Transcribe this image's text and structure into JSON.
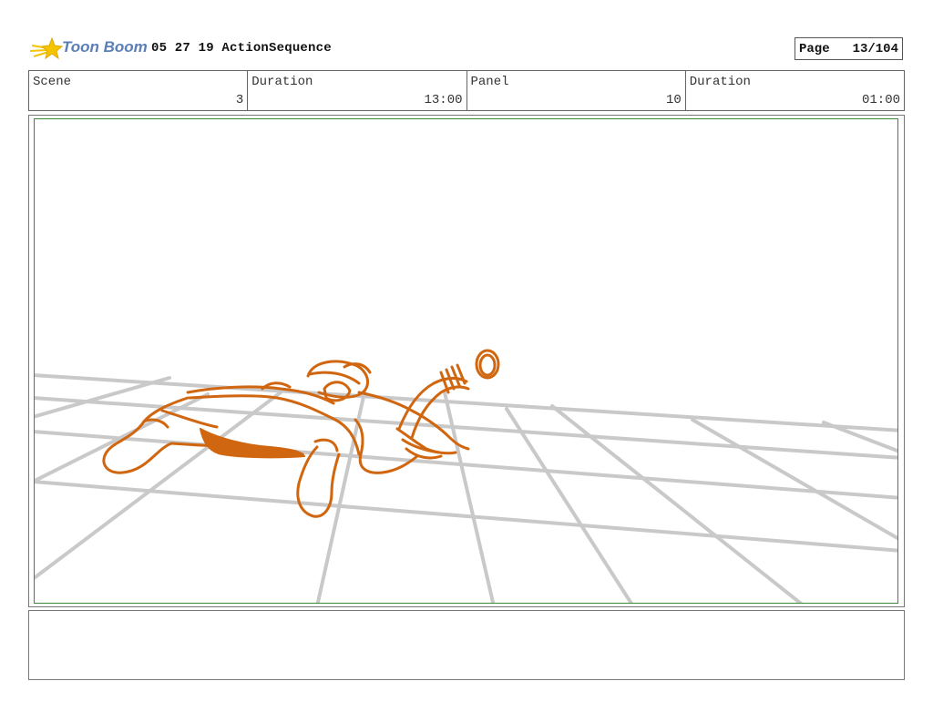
{
  "header": {
    "logo_text": "Toon Boom",
    "project_title": "05 27 19 ActionSequence",
    "page_label": "Page",
    "page_value": "13/104"
  },
  "info_bar": {
    "scene_label": "Scene",
    "scene_value": "3",
    "scene_duration_label": "Duration",
    "scene_duration_value": "13:00",
    "panel_label": "Panel",
    "panel_value": "10",
    "panel_duration_label": "Duration",
    "panel_duration_value": "01:00"
  },
  "colors": {
    "sketch_stroke": "#d0660f",
    "floor_grid": "#c9c9c9",
    "panel_border": "#3a8a3a",
    "logo_blue": "#5a7fb8",
    "logo_yellow": "#f5c400"
  },
  "icons": {
    "logo": "toon-boom-star-logo-icon"
  },
  "notes": {
    "text": ""
  }
}
